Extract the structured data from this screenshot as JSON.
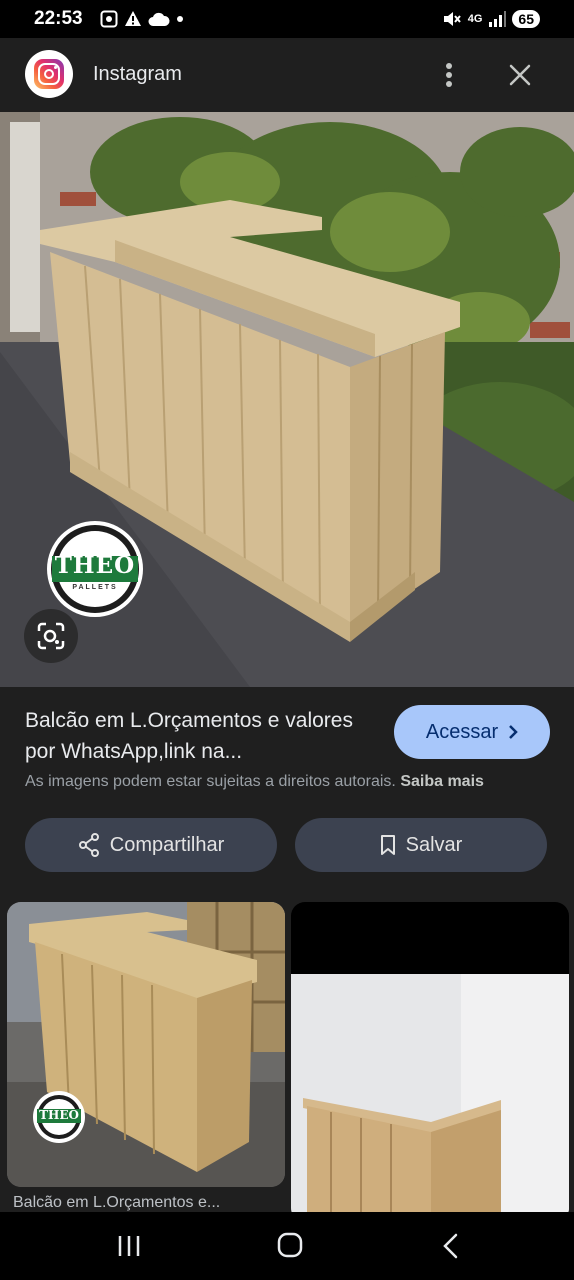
{
  "status_bar": {
    "time": "22:53",
    "network": "4G",
    "battery": "65"
  },
  "header": {
    "app_name": "Instagram"
  },
  "main_image": {
    "badge_text": "THEO",
    "badge_subtext": "PALLETS"
  },
  "info": {
    "title": "Balcão em L.Orçamentos e valores por WhatsApp,link na...",
    "access_label": "Acessar",
    "copyright_text": "As imagens podem estar sujeitas a direitos autorais.",
    "learn_more": "Saiba mais",
    "share_label": "Compartilhar",
    "save_label": "Salvar"
  },
  "related": {
    "items": [
      {
        "caption": "Balcão em L.Orçamentos e...",
        "badge_text": "THEO"
      },
      {
        "caption": ""
      }
    ]
  },
  "colors": {
    "panel_bg": "#1f1f1f",
    "accent_button": "#a8c7fa",
    "secondary_button": "#3c4250",
    "wood": "#d8c39a"
  }
}
